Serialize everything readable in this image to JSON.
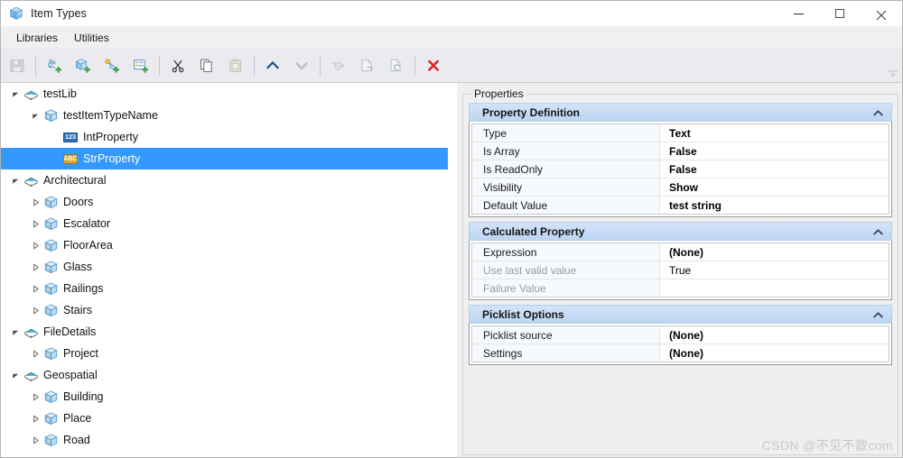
{
  "window": {
    "title": "Item Types",
    "icon": "cube-icon",
    "controls": {
      "minimize": "minimize-icon",
      "maximize": "maximize-icon",
      "close": "close-icon"
    }
  },
  "menubar": {
    "items": [
      {
        "label": "Libraries"
      },
      {
        "label": "Utilities"
      }
    ]
  },
  "toolbar": {
    "overflow": "toolbar-overflow-chevron",
    "buttons": [
      {
        "name": "save-button",
        "icon": "save-icon",
        "disabled": true
      },
      {
        "sep": true
      },
      {
        "name": "add-library-button",
        "icon": "add-library-icon",
        "disabled": false
      },
      {
        "name": "add-item-type-button",
        "icon": "add-item-type-icon",
        "disabled": false
      },
      {
        "name": "add-property-button",
        "icon": "add-property-icon",
        "disabled": false
      },
      {
        "name": "add-property-set-button",
        "icon": "add-property-set-icon",
        "disabled": false
      },
      {
        "sep": true
      },
      {
        "name": "cut-button",
        "icon": "scissors-icon",
        "disabled": false
      },
      {
        "name": "copy-button",
        "icon": "copy-icon",
        "disabled": false
      },
      {
        "name": "paste-button",
        "icon": "paste-icon",
        "disabled": true
      },
      {
        "sep": true
      },
      {
        "name": "move-up-button",
        "icon": "chevron-up-icon",
        "disabled": false
      },
      {
        "name": "move-down-button",
        "icon": "chevron-down-icon",
        "disabled": true
      },
      {
        "sep": true
      },
      {
        "name": "import-button",
        "icon": "import-icon",
        "disabled": true
      },
      {
        "name": "export-button",
        "icon": "export-icon",
        "disabled": true
      },
      {
        "name": "refresh-button",
        "icon": "refresh-doc-icon",
        "disabled": true
      },
      {
        "sep": true
      },
      {
        "name": "delete-button",
        "icon": "red-x-icon",
        "disabled": false
      }
    ]
  },
  "tree": {
    "rows": [
      {
        "label": "testLib",
        "indent": 0,
        "expander": "expanded",
        "icon": "library-icon",
        "selected": false
      },
      {
        "label": "testItemTypeName",
        "indent": 1,
        "expander": "expanded",
        "icon": "cube-icon",
        "selected": false
      },
      {
        "label": "IntProperty",
        "indent": 2,
        "expander": "none",
        "icon": "number-chip",
        "selected": false
      },
      {
        "label": "StrProperty",
        "indent": 2,
        "expander": "none",
        "icon": "text-chip",
        "selected": true
      },
      {
        "label": "Architectural",
        "indent": 0,
        "expander": "expanded",
        "icon": "library-icon",
        "selected": false
      },
      {
        "label": "Doors",
        "indent": 1,
        "expander": "collapsed",
        "icon": "cube-icon",
        "selected": false
      },
      {
        "label": "Escalator",
        "indent": 1,
        "expander": "collapsed",
        "icon": "cube-icon",
        "selected": false
      },
      {
        "label": "FloorArea",
        "indent": 1,
        "expander": "collapsed",
        "icon": "cube-icon",
        "selected": false
      },
      {
        "label": "Glass",
        "indent": 1,
        "expander": "collapsed",
        "icon": "cube-icon",
        "selected": false
      },
      {
        "label": "Railings",
        "indent": 1,
        "expander": "collapsed",
        "icon": "cube-icon",
        "selected": false
      },
      {
        "label": "Stairs",
        "indent": 1,
        "expander": "collapsed",
        "icon": "cube-icon",
        "selected": false
      },
      {
        "label": "FileDetails",
        "indent": 0,
        "expander": "expanded",
        "icon": "library-icon",
        "selected": false
      },
      {
        "label": "Project",
        "indent": 1,
        "expander": "collapsed",
        "icon": "cube-icon",
        "selected": false
      },
      {
        "label": "Geospatial",
        "indent": 0,
        "expander": "expanded",
        "icon": "library-icon",
        "selected": false
      },
      {
        "label": "Building",
        "indent": 1,
        "expander": "collapsed",
        "icon": "cube-icon",
        "selected": false
      },
      {
        "label": "Place",
        "indent": 1,
        "expander": "collapsed",
        "icon": "cube-icon",
        "selected": false
      },
      {
        "label": "Road",
        "indent": 1,
        "expander": "collapsed",
        "icon": "cube-icon",
        "selected": false
      }
    ]
  },
  "properties": {
    "group_legend": "Properties",
    "sections": [
      {
        "title": "Property Definition",
        "chevron": "chevron-up-icon",
        "rows": [
          {
            "label": "Type",
            "value": "Text",
            "dim": false,
            "bold": true
          },
          {
            "label": "Is Array",
            "value": "False",
            "dim": false,
            "bold": true
          },
          {
            "label": "Is ReadOnly",
            "value": "False",
            "dim": false,
            "bold": true
          },
          {
            "label": "Visibility",
            "value": "Show",
            "dim": false,
            "bold": true
          },
          {
            "label": "Default Value",
            "value": "test string",
            "dim": false,
            "bold": true
          }
        ]
      },
      {
        "title": "Calculated Property",
        "chevron": "chevron-up-icon",
        "rows": [
          {
            "label": "Expression",
            "value": "(None)",
            "dim": false,
            "bold": true
          },
          {
            "label": "Use last valid value",
            "value": "True",
            "dim": true,
            "bold": false
          },
          {
            "label": "Failure Value",
            "value": "",
            "dim": true,
            "bold": false
          }
        ]
      },
      {
        "title": "Picklist Options",
        "chevron": "chevron-up-icon",
        "rows": [
          {
            "label": "Picklist source",
            "value": "(None)",
            "dim": false,
            "bold": true
          },
          {
            "label": "Settings",
            "value": "(None)",
            "dim": false,
            "bold": true
          }
        ]
      }
    ]
  },
  "watermark": {
    "text": "CSDN @不见不散com"
  },
  "colors": {
    "selection": "#3399ff",
    "section_header": "#c7dcf5",
    "toolbar_bg": "#ebebef",
    "menubar_bg": "#f0f0f0",
    "props_bg": "#efefef",
    "delete_red": "#d9262c",
    "add_green": "#3aa03a"
  }
}
